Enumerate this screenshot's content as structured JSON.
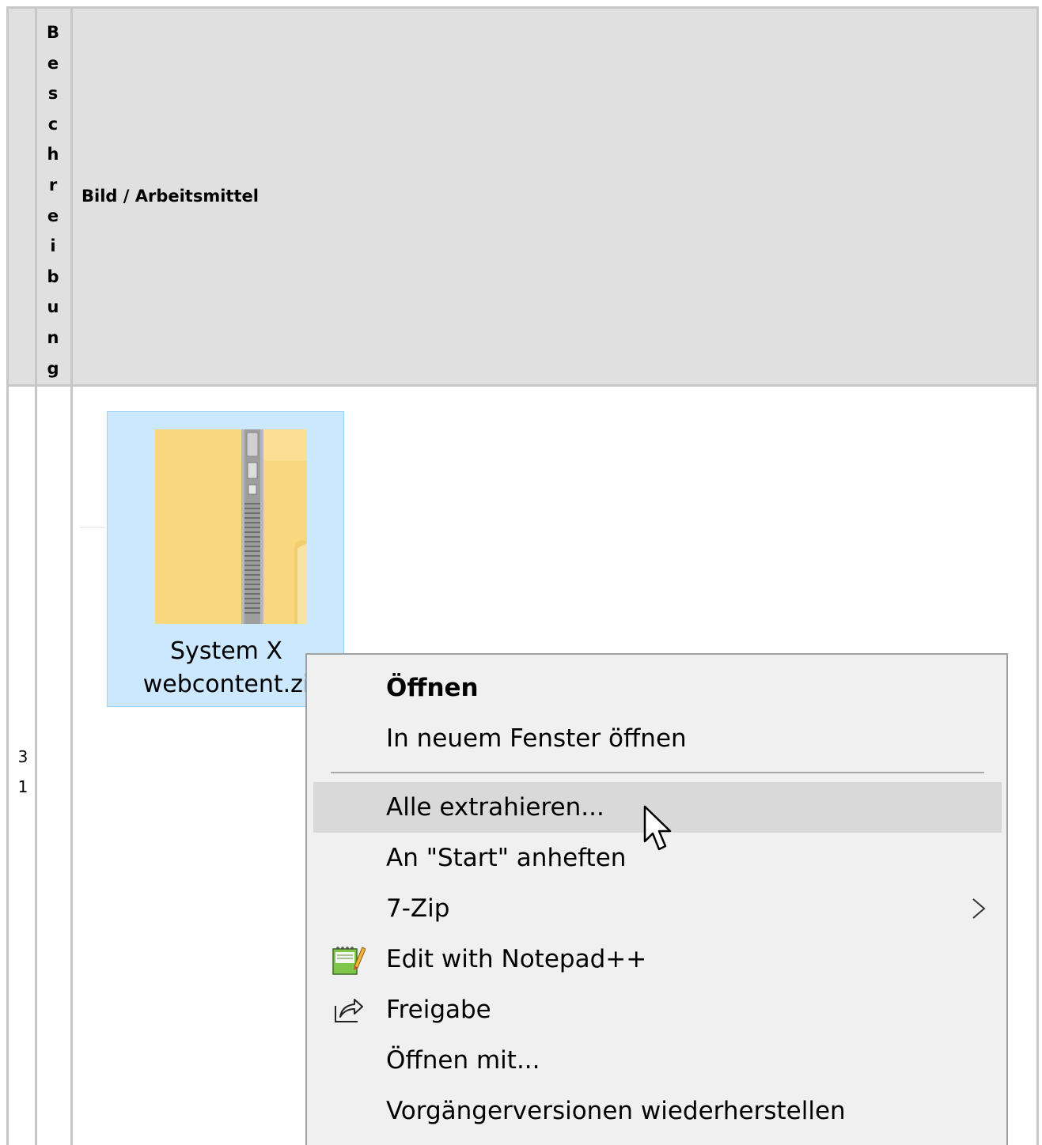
{
  "table": {
    "header_col1_letters": [
      "B",
      "e",
      "s",
      "c",
      "h",
      "r",
      "e",
      "i",
      "b",
      "u",
      "n",
      "g"
    ],
    "header_col2": "Bild / Arbeitsmittel",
    "row_number_digits": [
      "3",
      "1"
    ]
  },
  "file": {
    "icon": "zip-folder-icon",
    "name_line1": "System X",
    "name_line2": "webcontent.zi"
  },
  "context_menu": {
    "items": [
      {
        "label": "Öffnen",
        "bold": true
      },
      {
        "label": "In neuem Fenster öffnen"
      },
      {
        "label": "Alle extrahieren...",
        "hovered": true
      },
      {
        "label": "An \"Start\" anheften"
      },
      {
        "label": "7-Zip",
        "submenu": true,
        "icon": "chevron-right-icon"
      },
      {
        "label": "Edit with Notepad++",
        "icon": "notepad-plus-plus-icon"
      },
      {
        "label": "Freigabe",
        "icon": "share-icon"
      },
      {
        "label": "Öffnen mit..."
      },
      {
        "label": "Vorgängerversionen wiederherstellen"
      }
    ]
  },
  "colors": {
    "header_bg": "#e0e0e0",
    "grid": "#c8c8c8",
    "selection_bg": "#cce8ff",
    "selection_border": "#99d1ff",
    "menu_bg": "#f0f0f0",
    "menu_hover": "#d9d9d9"
  }
}
